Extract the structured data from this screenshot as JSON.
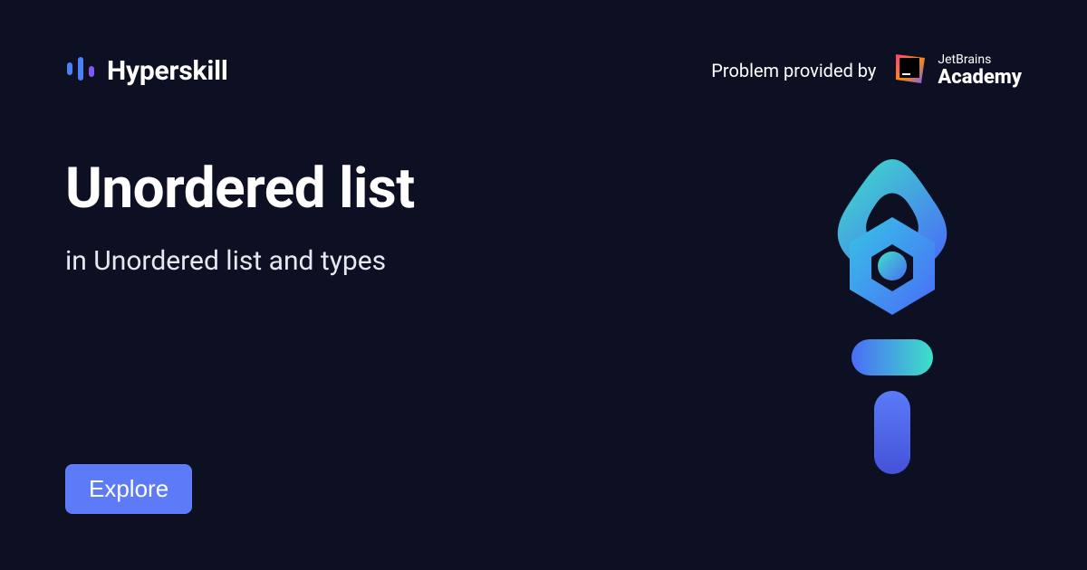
{
  "header": {
    "brand_name": "Hyperskill",
    "provided_label": "Problem provided by",
    "partner_line1": "JetBrains",
    "partner_line2": "Academy"
  },
  "main": {
    "title": "Unordered list",
    "subtitle": "in Unordered list and types"
  },
  "cta": {
    "label": "Explore"
  }
}
